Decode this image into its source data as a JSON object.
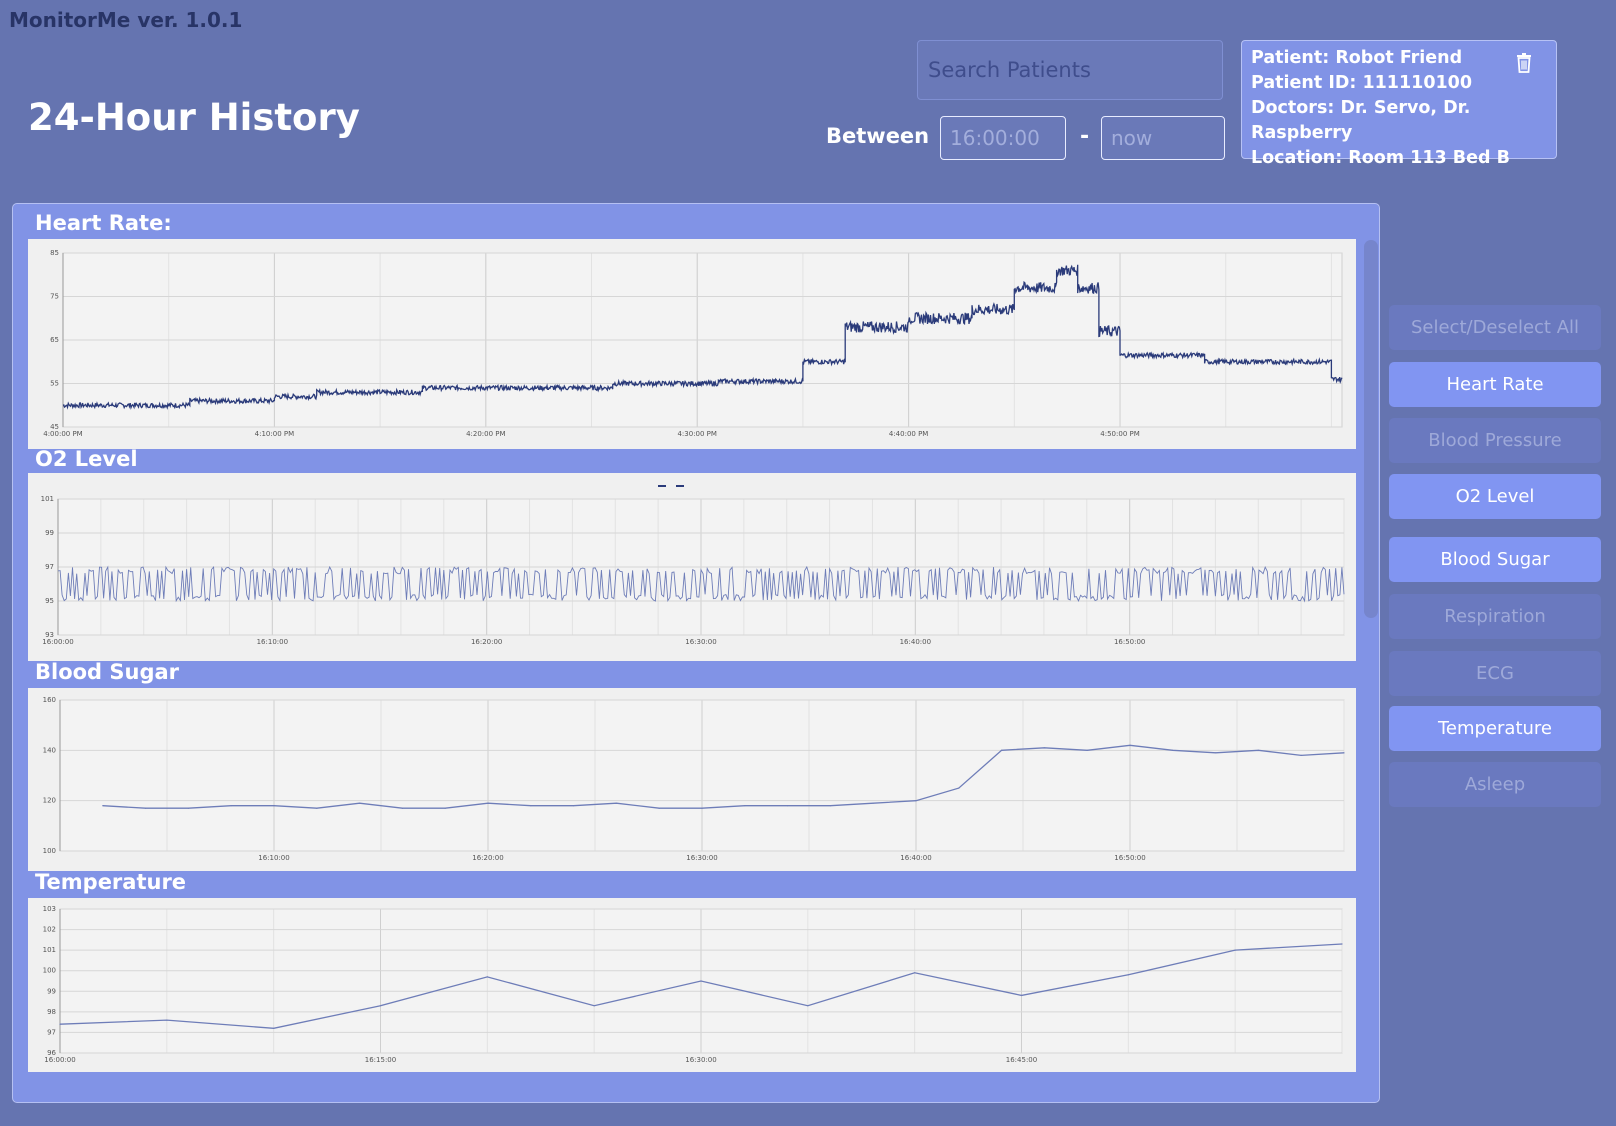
{
  "app": {
    "title": "MonitorMe ver. 1.0.1"
  },
  "header": {
    "page_title": "24-Hour History",
    "search_placeholder": "Search Patients",
    "between_label": "Between",
    "start_placeholder": "16:00:00",
    "range_separator": "-",
    "end_placeholder": "now"
  },
  "patient": {
    "name_line": "Patient: Robot Friend",
    "id_line": "Patient ID: 111110100",
    "doctors_line": "Doctors: Dr. Servo, Dr. Raspberry",
    "location_line": "Location: Room 113 Bed B"
  },
  "sections": {
    "heart_rate": "Heart Rate:",
    "o2": "O2 Level",
    "blood_sugar": "Blood Sugar",
    "temperature": "Temperature"
  },
  "sidebar": {
    "items": [
      {
        "label": "Select/Deselect All",
        "active": false
      },
      {
        "label": "Heart Rate",
        "active": true
      },
      {
        "label": "Blood Pressure",
        "active": false
      },
      {
        "label": "O2 Level",
        "active": true
      },
      {
        "label": "Blood Sugar",
        "active": true
      },
      {
        "label": "Respiration",
        "active": false
      },
      {
        "label": "ECG",
        "active": false
      },
      {
        "label": "Temperature",
        "active": true
      },
      {
        "label": "Asleep",
        "active": false
      }
    ]
  },
  "colors": {
    "background": "#6574b0",
    "panel": "#8193e6",
    "line_dark": "#2b3b7a",
    "line_light": "#6e7db8",
    "button_active": "#8195f2",
    "button_inactive": "#6a79bf"
  },
  "chart_data": [
    {
      "type": "line",
      "title": "Heart Rate:",
      "ylim": [
        45,
        85
      ],
      "yticks": [
        "45",
        "55",
        "65",
        "75",
        "85"
      ],
      "xticks": [
        "4:00:00 PM",
        "4:10:00 PM",
        "4:20:00 PM",
        "4:30:00 PM",
        "4:40:00 PM",
        "4:50:00 PM"
      ],
      "x_minutes": [
        0,
        6,
        10,
        12,
        17,
        26,
        31,
        35,
        37,
        40,
        43,
        45,
        47,
        48,
        49,
        50,
        54,
        58,
        60,
        60.5
      ],
      "values": [
        50,
        51,
        52,
        53,
        54,
        55,
        55.5,
        60,
        68,
        70,
        72,
        77,
        81,
        77,
        67,
        61.5,
        60,
        60,
        56,
        56
      ],
      "grid": true
    },
    {
      "type": "line",
      "title": "O2 Level",
      "ylim": [
        93,
        101
      ],
      "yticks": [
        "93",
        "95",
        "97",
        "99",
        "101"
      ],
      "xticks": [
        "16:00:00",
        "16:10:00",
        "16:20:00",
        "16:30:00",
        "16:40:00",
        "16:50:00"
      ],
      "x_minutes": [
        0,
        60
      ],
      "range": [
        95,
        97
      ],
      "note_values": "oscillates between 95 and 97",
      "grid": true
    },
    {
      "type": "line",
      "title": "Blood Sugar",
      "ylim": [
        100,
        160
      ],
      "yticks": [
        "100",
        "120",
        "140",
        "160"
      ],
      "xticks": [
        "16:10:00",
        "16:20:00",
        "16:30:00",
        "16:40:00",
        "16:50:00"
      ],
      "x_minutes": [
        2,
        4,
        6,
        8,
        10,
        12,
        14,
        16,
        18,
        20,
        22,
        24,
        26,
        28,
        30,
        32,
        34,
        36,
        38,
        40,
        42,
        44,
        46,
        48,
        50,
        52,
        54,
        56,
        58,
        60
      ],
      "values": [
        118,
        117,
        117,
        118,
        118,
        117,
        119,
        117,
        117,
        119,
        118,
        118,
        119,
        117,
        117,
        118,
        118,
        118,
        119,
        120,
        125,
        140,
        141,
        140,
        142,
        140,
        139,
        140,
        138,
        139
      ],
      "grid": true
    },
    {
      "type": "line",
      "title": "Temperature",
      "ylim": [
        96,
        103
      ],
      "yticks": [
        "96",
        "97",
        "98",
        "99",
        "100",
        "101",
        "102",
        "103"
      ],
      "xticks": [
        "16:00:00",
        "16:15:00",
        "16:30:00",
        "16:45:00"
      ],
      "x_minutes": [
        0,
        5,
        10,
        15,
        20,
        25,
        30,
        35,
        40,
        45,
        50,
        55,
        60
      ],
      "values": [
        97.4,
        97.6,
        97.2,
        98.3,
        99.7,
        98.3,
        99.5,
        98.3,
        99.9,
        98.8,
        99.8,
        101.0,
        101.3
      ],
      "grid": true
    }
  ]
}
